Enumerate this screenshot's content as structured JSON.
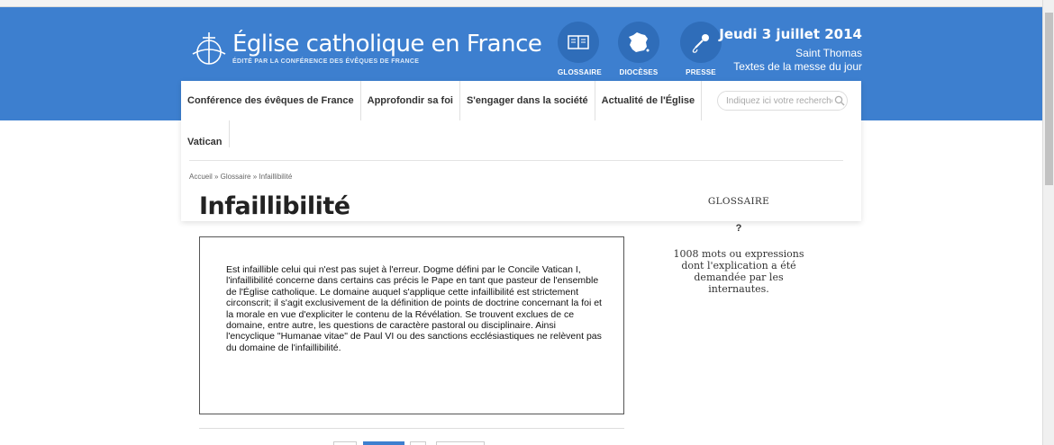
{
  "header": {
    "site_title": "Église catholique en France",
    "site_subtitle": "ÉDITÉ PAR LA CONFÉRENCE DES ÉVÊQUES DE FRANCE",
    "icons": [
      {
        "label": "GLOSSAIRE",
        "icon": "book-icon"
      },
      {
        "label": "DIOCÈSES",
        "icon": "france-map-icon"
      },
      {
        "label": "PRESSE",
        "icon": "microphone-icon"
      }
    ],
    "date": "Jeudi 3 juillet 2014",
    "saint": "Saint Thomas",
    "messe_link": "Textes de la messe du jour"
  },
  "nav": {
    "items": [
      "Conférence des évêques de France",
      "Approfondir sa foi",
      "S'engager dans la société",
      "Actualité de l'Église",
      "Vatican"
    ]
  },
  "search": {
    "placeholder": "Indiquez ici votre recherche"
  },
  "breadcrumb": "Accueil » Glossaire » Infaillibilité",
  "main": {
    "title": "Infaillibilité",
    "definition": "Est infaillible celui qui n'est pas sujet à l'erreur. Dogme défini par le Concile Vatican I, l'infaillibilité concerne dans certains cas précis le Pape en tant que pasteur de l'ensemble de l'Église catholique. Le domaine auquel s'applique cette infaillibilité est strictement circonscrit; il s'agit exclusivement de la définition de points de doctrine concernant la foi et la morale en vue d'expliciter le contenu de la Révélation. Se trouvent exclues de ce domaine, entre autre, les questions de caractère pastoral ou disciplinaire. Ainsi l'encyclique \"Humanae vitae\" de Paul VI ou des sanctions ecclésiastiques ne relèvent pas du domaine de l'infaillibilité."
  },
  "sidebar": {
    "title": "GLOSSAIRE",
    "question": "?",
    "description": "1008 mots ou expressions dont l'explication a été demandée par les internautes."
  },
  "colors": {
    "header_blue": "#3d7fcf",
    "icon_circle": "#2f6db9"
  }
}
